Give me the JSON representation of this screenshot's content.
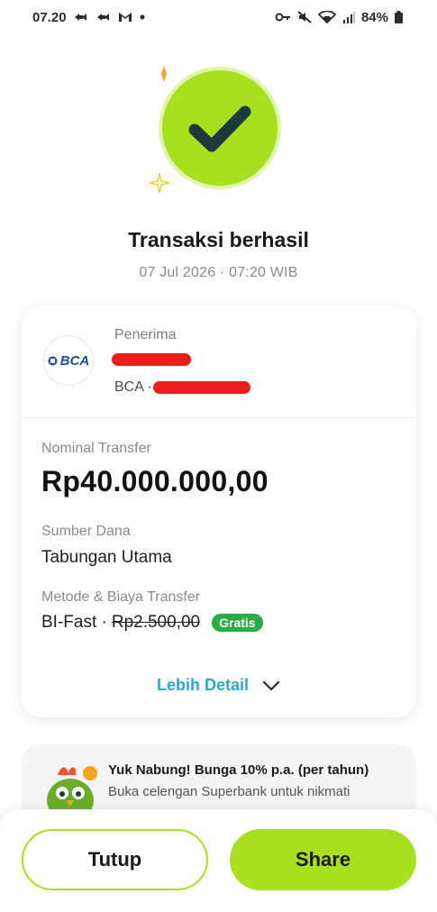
{
  "status_bar": {
    "time": "07.20",
    "battery": "84%"
  },
  "header": {
    "title": "Transaksi berhasil",
    "timestamp": "07 Jul 2026 · 07:20 WIB"
  },
  "recipient": {
    "label": "Penerima",
    "bank_logo_text": "BCA",
    "bank_name": "BCA ·"
  },
  "details": {
    "amount_label": "Nominal Transfer",
    "amount_value": "Rp40.000.000,00",
    "source_label": "Sumber Dana",
    "source_value": "Tabungan Utama",
    "method_label": "Metode & Biaya Transfer",
    "method_value": "BI-Fast ·",
    "original_fee": "Rp2.500,00",
    "fee_badge": "Gratis",
    "more_detail_label": "Lebih Detail"
  },
  "promo": {
    "title": "Yuk Nabung! Bunga 10% p.a. (per tahun)",
    "body": "Buka celengan Superbank untuk nikmati"
  },
  "actions": {
    "close_label": "Tutup",
    "share_label": "Share"
  },
  "colors": {
    "accent": "#A8E01F",
    "check": "#1C3A3E",
    "link": "#2AA8D6",
    "badge": "#27AE44",
    "redaction": "#EE1C1C"
  },
  "icons": [
    "link-icon",
    "mail-icon",
    "key-icon",
    "mute-icon",
    "wifi-icon",
    "signal-icon",
    "battery-icon",
    "checkmark-icon",
    "sparkle-icon",
    "bca-logo",
    "chevron-down-icon",
    "mascot-icon"
  ]
}
